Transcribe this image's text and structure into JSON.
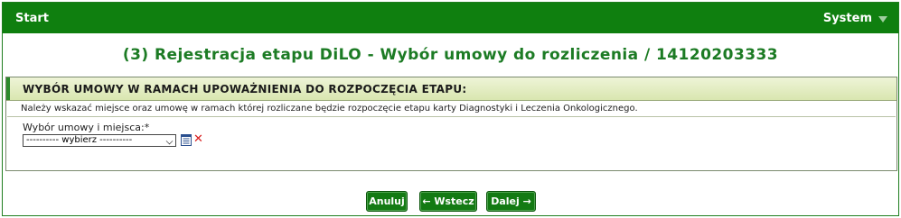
{
  "header": {
    "start": "Start",
    "system": "System",
    "caret_icon": "chevron-down-icon"
  },
  "title": "(3) Rejestracja etapu DiLO - Wybór umowy do rozliczenia / 14120203333",
  "section": {
    "header": "WYBÓR UMOWY W RAMACH UPOWAŻNIENIA DO ROZPOCZĘCIA ETAPU:",
    "info": "Należy wskazać miejsce oraz umowę w ramach której rozliczane będzie rozpoczęcie etapu karty Diagnostyki i Leczenia Onkologicznego.",
    "field_label": "Wybór umowy i miejsca:*",
    "select_value": "---------- wybierz ----------",
    "list_icon": "list-icon",
    "clear_icon": "clear-icon"
  },
  "buttons": {
    "cancel": "Anuluj",
    "back": "← Wstecz",
    "next": "Dalej →"
  },
  "colors": {
    "header_bg": "#0f7f0f",
    "title": "#1c7b24",
    "button_bg": "#137a13",
    "clear_red": "#d81c1c"
  }
}
